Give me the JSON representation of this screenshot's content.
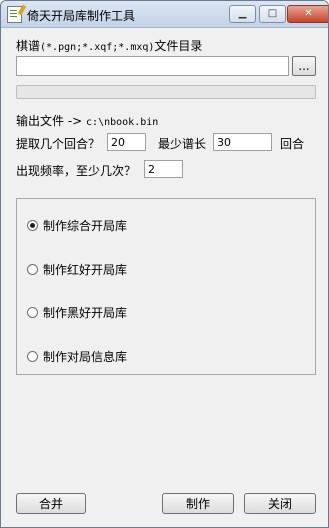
{
  "window": {
    "title": "倚天开局库制作工具",
    "minimize_glyph": "▁",
    "maximize_glyph": "□",
    "close_glyph": "✕"
  },
  "source": {
    "label_prefix": "棋谱",
    "label_pattern": "(*.pgn;*.xqf;*.mxq)",
    "label_suffix": "文件目录",
    "path_value": "",
    "browse_label": "..."
  },
  "progress": {
    "fraction": 0
  },
  "output": {
    "label": "输出文件 ->",
    "path": "c:\\nbook.bin"
  },
  "extract": {
    "moves_label": "提取几个回合？",
    "moves_value": "20",
    "min_length_label": "最少谱长",
    "min_length_value": "30",
    "unit_label": "回合"
  },
  "frequency": {
    "label": "出现频率，至少几次？",
    "value": "2"
  },
  "options": [
    {
      "label": "制作综合开局库",
      "checked": true
    },
    {
      "label": "制作红好开局库",
      "checked": false
    },
    {
      "label": "制作黑好开局库",
      "checked": false
    },
    {
      "label": "制作对局信息库",
      "checked": false
    }
  ],
  "buttons": {
    "merge": "合并",
    "make": "制作",
    "close": "关闭"
  }
}
